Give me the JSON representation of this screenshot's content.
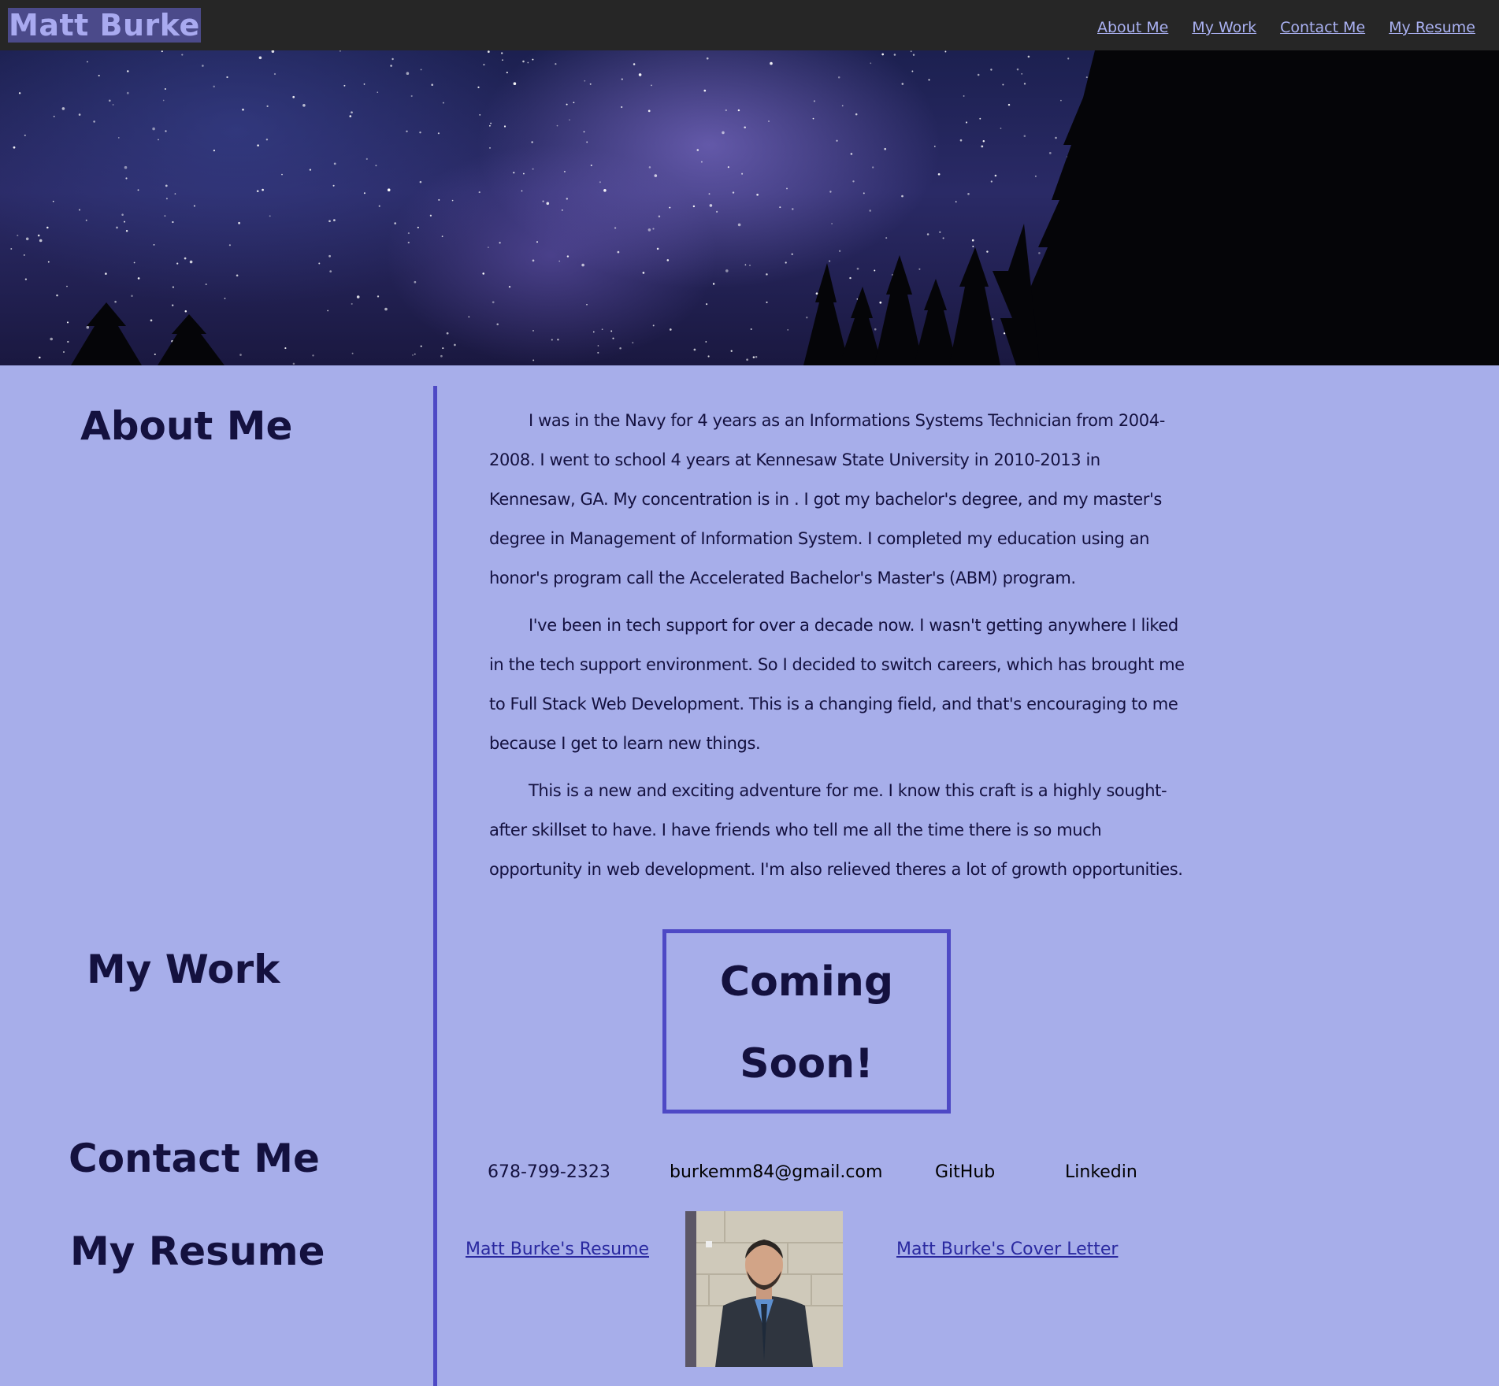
{
  "header": {
    "brand": "Matt Burke",
    "nav": [
      "About Me",
      "My Work",
      "Contact Me",
      "My Resume"
    ]
  },
  "sidebar": {
    "about": "About Me",
    "work": "My Work",
    "contact": "Contact Me",
    "resume": "My Resume"
  },
  "about": {
    "paragraphs": [
      "I was in the Navy for 4 years as an Informations Systems Technician from 2004-2008. I went to school 4 years at Kennesaw State University in 2010-2013 in Kennesaw, GA. My concentration is in . I got my bachelor's degree, and my master's degree in Management of Information System. I completed my education using an honor's program call the Accelerated Bachelor's Master's (ABM) program.",
      "I've been in tech support for over a decade now. I wasn't getting anywhere I liked in the tech support environment. So I decided to switch careers, which has brought me to Full Stack Web Development. This is a changing field, and that's encouraging to me because I get to learn new things.",
      "This is a new and exciting adventure for me. I know this craft is a highly sought-after skillset to have. I have friends who tell me all the time there is so much opportunity in web development. I'm also relieved theres a lot of growth opportunities."
    ]
  },
  "work": {
    "placeholder_line1": "Coming",
    "placeholder_line2": "Soon!"
  },
  "contact": {
    "phone": "678-799-2323",
    "email": "burkemm84@gmail.com",
    "github": "GitHub",
    "linkedin": "Linkedin"
  },
  "resume": {
    "resume_link": "Matt Burke's Resume",
    "cover_letter_link": "Matt Burke's Cover Letter"
  },
  "colors": {
    "page_bg": "#a7aeea",
    "topbar_bg": "#262626",
    "accent": "#4e49c5",
    "heading": "#14113f",
    "link": "#2a29a0"
  }
}
